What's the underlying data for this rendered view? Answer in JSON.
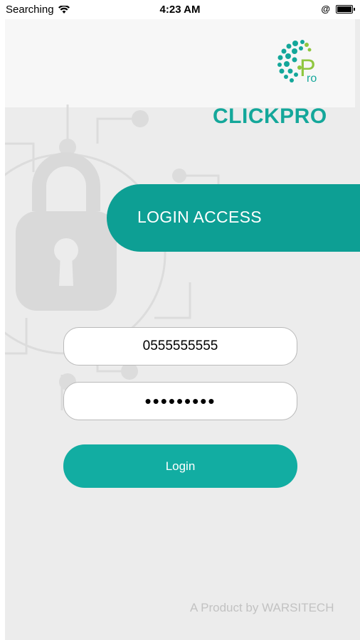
{
  "status_bar": {
    "carrier": "Searching",
    "time": "4:23 AM",
    "wifi_icon": "wifi-icon",
    "alarm_icon": "@",
    "battery_icon": "battery-icon"
  },
  "header": {
    "logo_letter": "P",
    "logo_sub": "ro",
    "brand": "CLICKPRO"
  },
  "login_banner": {
    "title": "LOGIN ACCESS"
  },
  "form": {
    "phone_value": "0555555555",
    "password_value": "•••••••••",
    "login_label": "Login"
  },
  "footer": {
    "text": "A Product by WARSITECH"
  },
  "colors": {
    "accent": "#0d9f94",
    "button": "#12ada2",
    "brand_text": "#14a79a",
    "logo_green": "#8fc63f"
  }
}
